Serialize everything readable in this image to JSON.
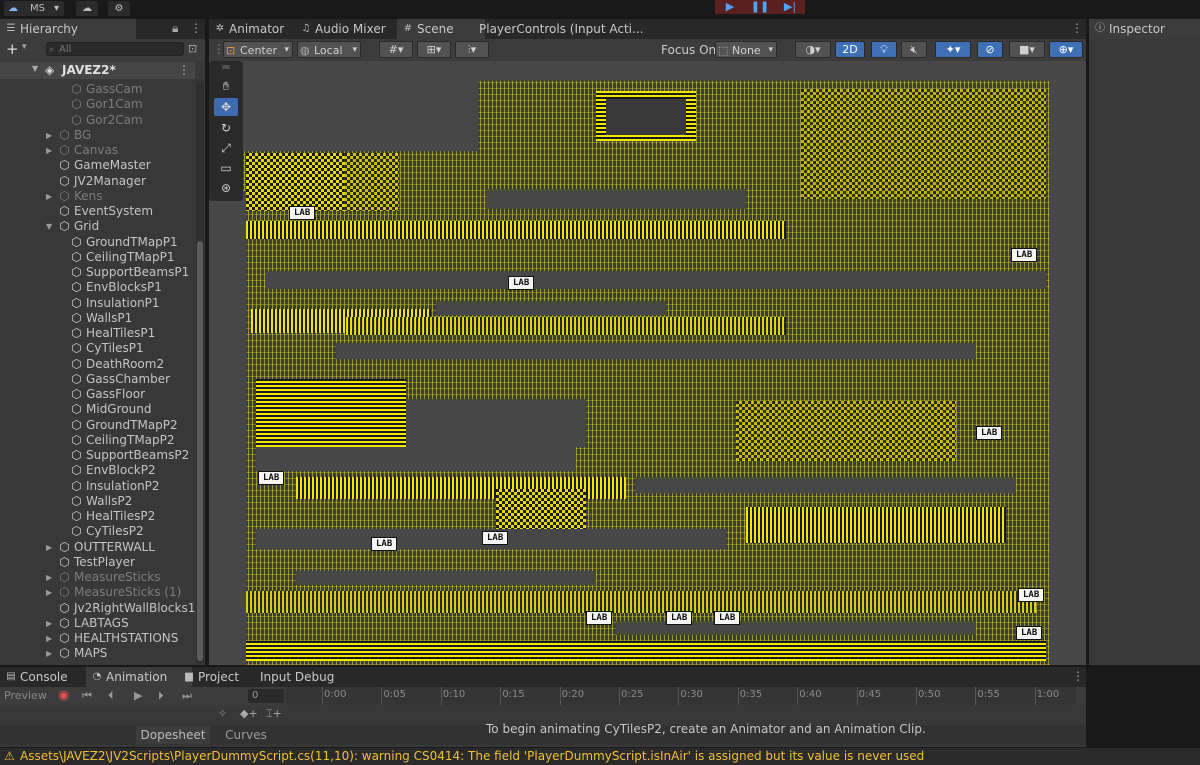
{
  "topbar": {
    "account": "MS",
    "account_arrow": "▾",
    "play": "▶",
    "pause": "❚❚",
    "step": "▶|"
  },
  "hierarchy": {
    "tab": "Hierarchy",
    "search_placeholder": "All",
    "add": "+",
    "root": "JAVEZ2*",
    "items": [
      {
        "label": "GassCam",
        "depth": 2,
        "dim": true,
        "arrow": ""
      },
      {
        "label": "Gor1Cam",
        "depth": 2,
        "dim": true,
        "arrow": ""
      },
      {
        "label": "Gor2Cam",
        "depth": 2,
        "dim": true,
        "arrow": ""
      },
      {
        "label": "BG",
        "depth": 1,
        "dim": true,
        "arrow": "▶"
      },
      {
        "label": "Canvas",
        "depth": 1,
        "dim": true,
        "arrow": "▶"
      },
      {
        "label": "GameMaster",
        "depth": 1,
        "dim": false,
        "arrow": ""
      },
      {
        "label": "JV2Manager",
        "depth": 1,
        "dim": false,
        "arrow": ""
      },
      {
        "label": "Kens",
        "depth": 1,
        "dim": true,
        "arrow": "▶"
      },
      {
        "label": "EventSystem",
        "depth": 1,
        "dim": false,
        "arrow": ""
      },
      {
        "label": "Grid",
        "depth": 1,
        "dim": false,
        "arrow": "▼"
      },
      {
        "label": "GroundTMapP1",
        "depth": 2,
        "dim": false,
        "arrow": ""
      },
      {
        "label": "CeilingTMapP1",
        "depth": 2,
        "dim": false,
        "arrow": ""
      },
      {
        "label": "SupportBeamsP1",
        "depth": 2,
        "dim": false,
        "arrow": ""
      },
      {
        "label": "EnvBlocksP1",
        "depth": 2,
        "dim": false,
        "arrow": ""
      },
      {
        "label": "InsulationP1",
        "depth": 2,
        "dim": false,
        "arrow": ""
      },
      {
        "label": "WallsP1",
        "depth": 2,
        "dim": false,
        "arrow": ""
      },
      {
        "label": "HealTilesP1",
        "depth": 2,
        "dim": false,
        "arrow": ""
      },
      {
        "label": "CyTilesP1",
        "depth": 2,
        "dim": false,
        "arrow": ""
      },
      {
        "label": "DeathRoom2",
        "depth": 2,
        "dim": false,
        "arrow": ""
      },
      {
        "label": "GassChamber",
        "depth": 2,
        "dim": false,
        "arrow": ""
      },
      {
        "label": "GassFloor",
        "depth": 2,
        "dim": false,
        "arrow": ""
      },
      {
        "label": "MidGround",
        "depth": 2,
        "dim": false,
        "arrow": ""
      },
      {
        "label": "GroundTMapP2",
        "depth": 2,
        "dim": false,
        "arrow": ""
      },
      {
        "label": "CeilingTMapP2",
        "depth": 2,
        "dim": false,
        "arrow": ""
      },
      {
        "label": "SupportBeamsP2",
        "depth": 2,
        "dim": false,
        "arrow": ""
      },
      {
        "label": "EnvBlockP2",
        "depth": 2,
        "dim": false,
        "arrow": ""
      },
      {
        "label": "InsulationP2",
        "depth": 2,
        "dim": false,
        "arrow": ""
      },
      {
        "label": "WallsP2",
        "depth": 2,
        "dim": false,
        "arrow": ""
      },
      {
        "label": "HealTilesP2",
        "depth": 2,
        "dim": false,
        "arrow": ""
      },
      {
        "label": "CyTilesP2",
        "depth": 2,
        "dim": false,
        "arrow": ""
      },
      {
        "label": "OUTTERWALL",
        "depth": 1,
        "dim": false,
        "arrow": "▶"
      },
      {
        "label": "TestPlayer",
        "depth": 1,
        "dim": false,
        "arrow": ""
      },
      {
        "label": "MeasureSticks",
        "depth": 1,
        "dim": true,
        "arrow": "▶"
      },
      {
        "label": "MeasureSticks (1)",
        "depth": 1,
        "dim": true,
        "arrow": "▶"
      },
      {
        "label": "Jv2RightWallBlocks1,",
        "depth": 1,
        "dim": false,
        "arrow": ""
      },
      {
        "label": "LABTAGS",
        "depth": 1,
        "dim": false,
        "arrow": "▶"
      },
      {
        "label": "HEALTHSTATIONS",
        "depth": 1,
        "dim": false,
        "arrow": "▶"
      },
      {
        "label": "MAPS",
        "depth": 1,
        "dim": false,
        "arrow": "▶"
      }
    ]
  },
  "scene": {
    "tabs": [
      {
        "label": "Animator",
        "icon": "✲"
      },
      {
        "label": "Audio Mixer",
        "icon": "♫"
      },
      {
        "label": "Scene",
        "icon": "#"
      },
      {
        "label": "PlayerControls (Input Acti...",
        "icon": ""
      }
    ],
    "toolbar": {
      "pivot": "Center",
      "space": "Local",
      "focus_label": "Focus On",
      "focus_value": "None",
      "mode_2d": "2D"
    },
    "lab_label": "LAB"
  },
  "inspector": {
    "tab": "Inspector"
  },
  "bottom": {
    "tabs": [
      {
        "label": "Console",
        "icon": "▤"
      },
      {
        "label": "Animation",
        "icon": "◔"
      },
      {
        "label": "Project",
        "icon": "▆"
      },
      {
        "label": "Input Debug",
        "icon": ""
      }
    ],
    "preview": "Preview",
    "frame": "0",
    "ticks": [
      "0:00",
      "0:05",
      "0:10",
      "0:15",
      "0:20",
      "0:25",
      "0:30",
      "0:35",
      "0:40",
      "0:45",
      "0:50",
      "0:55",
      "1:00"
    ],
    "message": "To begin animating CyTilesP2, create an Animator and an Animation Clip.",
    "dopesheet": "Dopesheet",
    "curves": "Curves"
  },
  "status": {
    "message": "Assets\\JAVEZ2\\JV2Scripts\\PlayerDummyScript.cs(11,10): warning CS0414: The field 'PlayerDummyScript.isInAir' is assigned but its value is never used"
  },
  "colors": {
    "accent": "#3d6ab0",
    "tile_yellow": "#f2e600",
    "warning": "#f2c037"
  }
}
